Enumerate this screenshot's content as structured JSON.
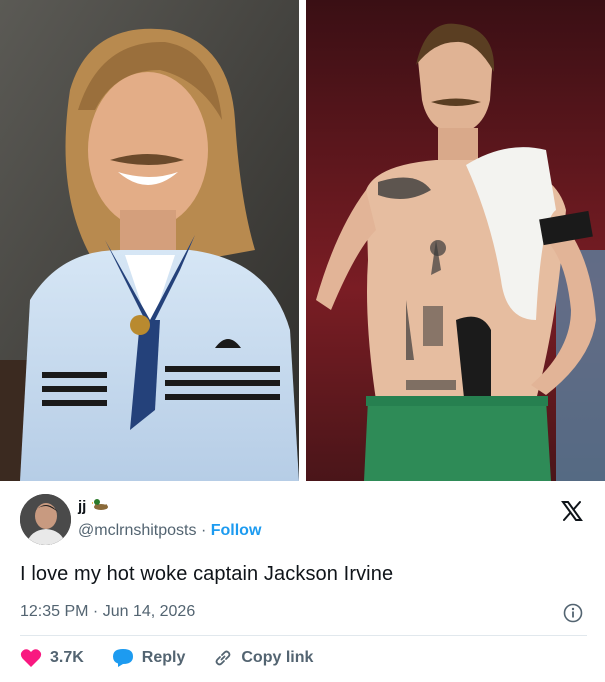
{
  "tweet": {
    "display_name": "jj",
    "handle": "@mclrnshitposts",
    "separator": "·",
    "follow_label": "Follow",
    "text": "I love my hot woke captain Jackson Irvine",
    "timestamp": "12:35 PM · Jun 14, 2026",
    "likes": "3.7K",
    "reply_label": "Reply",
    "copy_link_label": "Copy link"
  },
  "icons": {
    "brand": "x-logo-icon",
    "emoji": "duck-emoji-icon",
    "info": "info-icon",
    "like": "heart-icon",
    "reply": "reply-bubble-icon",
    "copy": "link-icon"
  },
  "colors": {
    "link": "#1d9bf0",
    "like": "#f91880",
    "text": "#0f1419",
    "muted": "#536471"
  }
}
